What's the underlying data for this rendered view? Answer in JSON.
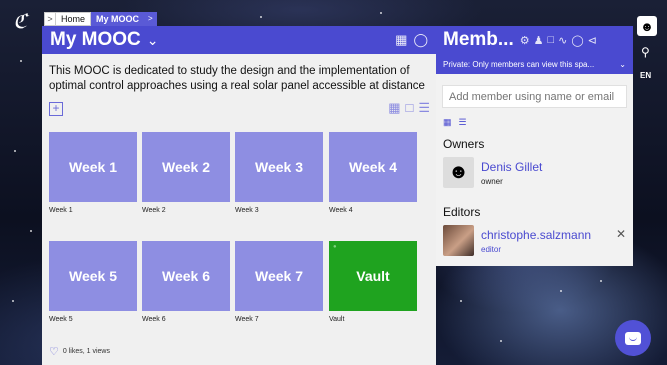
{
  "app": {
    "logo_glyph": "ℭ"
  },
  "breadcrumb": {
    "home": "Home",
    "current": "My MOOC"
  },
  "main": {
    "title": "My MOOC",
    "description": "This MOOC is dedicated to study the design and the implementation of optimal control approaches using a real solar panel accessible at distance",
    "tiles": [
      {
        "label": "Week 1",
        "caption": "Week 1"
      },
      {
        "label": "Week 2",
        "caption": "Week 2"
      },
      {
        "label": "Week 3",
        "caption": "Week 3"
      },
      {
        "label": "Week 4",
        "caption": "Week 4"
      },
      {
        "label": "Week 5",
        "caption": "Week 5"
      },
      {
        "label": "Week 6",
        "caption": "Week 6"
      },
      {
        "label": "Week 7",
        "caption": "Week 7"
      },
      {
        "label": "Vault",
        "caption": "Vault"
      }
    ],
    "likes": "0 likes, 1 views"
  },
  "members": {
    "title": "Memb...",
    "private_notice": "Private: Only members can view this spa...",
    "input_placeholder": "Add member using name or email",
    "owners_label": "Owners",
    "editors_label": "Editors",
    "owners": [
      {
        "name": "Denis Gillet",
        "role": "owner"
      }
    ],
    "editors": [
      {
        "name": "christophe.salzmann",
        "role": "editor"
      }
    ]
  },
  "side": {
    "language": "EN"
  },
  "colors": {
    "accent": "#4a4ad0",
    "tile": "#8e8ee2",
    "vault": "#1fa31f"
  }
}
